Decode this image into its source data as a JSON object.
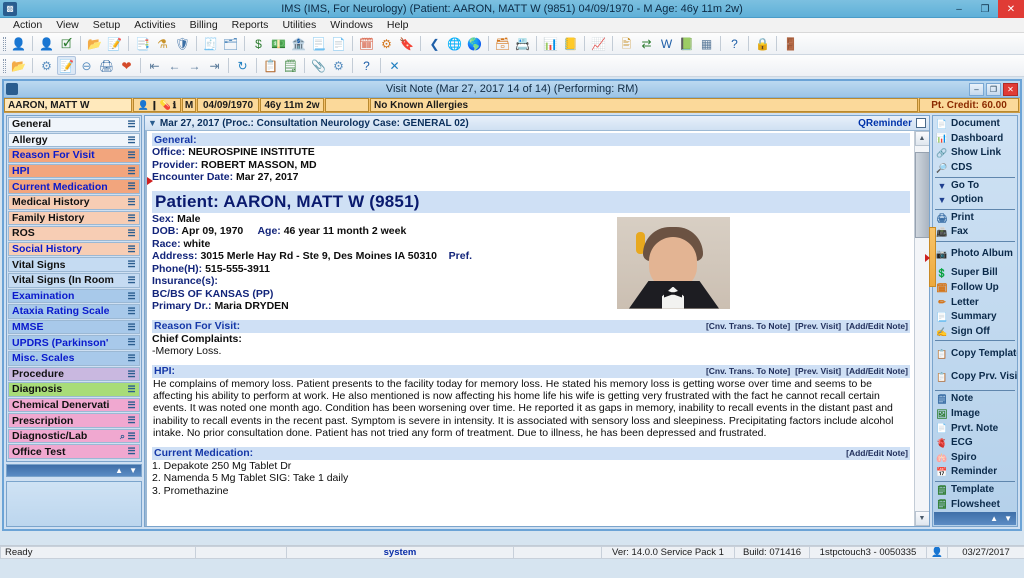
{
  "window": {
    "title": "IMS (IMS, For Neurology)   (Patient: AARON, MATT W (9851) 04/09/1970 - M Age: 46y 11m 2w)",
    "app_icon": "app-icon",
    "minimize": "–",
    "maximize": "❐",
    "close": "✕"
  },
  "menubar": {
    "items": [
      {
        "label": "Action"
      },
      {
        "label": "View"
      },
      {
        "label": "Setup"
      },
      {
        "label": "Activities"
      },
      {
        "label": "Billing"
      },
      {
        "label": "Reports"
      },
      {
        "label": "Utilities"
      },
      {
        "label": "Windows"
      },
      {
        "label": "Help"
      }
    ]
  },
  "toolbar_primary": {
    "groups": [
      {
        "buttons": [
          {
            "icon": "person-icon",
            "glyph": "👤",
            "color": "#e08a2a"
          }
        ]
      },
      {
        "buttons": [
          {
            "icon": "person-add-icon",
            "glyph": "👤",
            "color": "#d4761c"
          },
          {
            "icon": "person-check-icon",
            "glyph": "🗹",
            "color": "#2f7d32"
          }
        ]
      },
      {
        "buttons": [
          {
            "icon": "folder-open-icon",
            "glyph": "📂",
            "color": "#e0a020"
          },
          {
            "icon": "edit-note-icon",
            "glyph": "📝",
            "color": "#d4761c"
          }
        ]
      },
      {
        "buttons": [
          {
            "icon": "chart-review-icon",
            "glyph": "📑",
            "color": "#3a6ea5"
          },
          {
            "icon": "lab-flask-icon",
            "glyph": "⚗",
            "color": "#c8922a"
          },
          {
            "icon": "shield-icon",
            "glyph": "🛡",
            "color": "#3a6ea5"
          }
        ]
      },
      {
        "buttons": [
          {
            "icon": "claim-icon",
            "glyph": "🧾",
            "color": "#3a6ea5"
          },
          {
            "icon": "document-stack-icon",
            "glyph": "🗂",
            "color": "#5a8fc0"
          }
        ]
      },
      {
        "buttons": [
          {
            "icon": "payment-icon",
            "glyph": "$",
            "color": "#2f7d32"
          },
          {
            "icon": "payment-post-icon",
            "glyph": "💵",
            "color": "#2f7d32"
          },
          {
            "icon": "ledger-icon",
            "glyph": "🏦",
            "color": "#3a6ea5"
          },
          {
            "icon": "statement-icon",
            "glyph": "📃",
            "color": "#c8922a"
          },
          {
            "icon": "collections-icon",
            "glyph": "📄",
            "color": "#5a8fc0"
          }
        ]
      },
      {
        "buttons": [
          {
            "icon": "calendar-icon",
            "glyph": "🗓",
            "color": "#d44a2a"
          },
          {
            "icon": "schedule-icon",
            "glyph": "⚙",
            "color": "#d4761c"
          },
          {
            "icon": "appointment-icon",
            "glyph": "🔖",
            "color": "#3a6ea5"
          }
        ]
      },
      {
        "buttons": [
          {
            "icon": "back-arrow-icon",
            "glyph": "❮",
            "color": "#1f5fa8"
          },
          {
            "icon": "globe-icon",
            "glyph": "🌐",
            "color": "#2a7a9a"
          },
          {
            "icon": "globe-alt-icon",
            "glyph": "🌎",
            "color": "#2a7a9a"
          }
        ]
      },
      {
        "buttons": [
          {
            "icon": "eligibility-icon",
            "glyph": "🗃",
            "color": "#d4761c"
          },
          {
            "icon": "claim-status-icon",
            "glyph": "📇",
            "color": "#5a8fc0"
          }
        ]
      },
      {
        "buttons": [
          {
            "icon": "bar-chart-icon",
            "glyph": "📊",
            "color": "#2f7d32"
          },
          {
            "icon": "report-icon",
            "glyph": "📒",
            "color": "#c8922a"
          }
        ]
      },
      {
        "buttons": [
          {
            "icon": "analytics-icon",
            "glyph": "📈",
            "color": "#3a6ea5"
          }
        ]
      },
      {
        "buttons": [
          {
            "icon": "scan-doc-icon",
            "glyph": "🖹",
            "color": "#c8922a"
          },
          {
            "icon": "transfer-icon",
            "glyph": "⇄",
            "color": "#2f7d32"
          },
          {
            "icon": "word-export-icon",
            "glyph": "W",
            "color": "#1f5fa8"
          },
          {
            "icon": "excel-export-icon",
            "glyph": "📗",
            "color": "#2f7d32"
          },
          {
            "icon": "grid-view-icon",
            "glyph": "▦",
            "color": "#5a7a9a"
          }
        ]
      },
      {
        "buttons": [
          {
            "icon": "help-icon",
            "glyph": "?",
            "color": "#1f5fa8"
          }
        ]
      },
      {
        "buttons": [
          {
            "icon": "lock-icon",
            "glyph": "🔒",
            "color": "#d4a01c"
          }
        ]
      },
      {
        "buttons": [
          {
            "icon": "exit-icon",
            "glyph": "🚪",
            "color": "#3a6ea5"
          }
        ]
      }
    ]
  },
  "toolbar_secondary": {
    "groups": [
      {
        "buttons": [
          {
            "icon": "open-chart-icon",
            "glyph": "📂",
            "color": "#e0a020"
          }
        ]
      },
      {
        "buttons": [
          {
            "icon": "add-visit-icon",
            "glyph": "⚙",
            "color": "#5a8fc0"
          },
          {
            "icon": "edit-visit-icon",
            "glyph": "📝",
            "color": "#d4761c",
            "active": true
          },
          {
            "icon": "delete-visit-icon",
            "glyph": "⊖",
            "color": "#5a8fc0"
          },
          {
            "icon": "print-preview-icon",
            "glyph": "🖨",
            "color": "#3a6ea5"
          },
          {
            "icon": "favorite-icon",
            "glyph": "❤",
            "color": "#d44a2a"
          }
        ]
      },
      {
        "buttons": [
          {
            "icon": "first-record-icon",
            "glyph": "⇤",
            "color": "#5a7a9a"
          },
          {
            "icon": "prev-record-icon",
            "glyph": "←",
            "color": "#5a7a9a"
          },
          {
            "icon": "next-record-icon",
            "glyph": "→",
            "color": "#5a7a9a"
          },
          {
            "icon": "last-record-icon",
            "glyph": "⇥",
            "color": "#5a7a9a"
          }
        ]
      },
      {
        "buttons": [
          {
            "icon": "refresh-icon",
            "glyph": "↻",
            "color": "#1f7fc0"
          }
        ]
      },
      {
        "buttons": [
          {
            "icon": "copy-icon",
            "glyph": "📋",
            "color": "#5a8fc0"
          },
          {
            "icon": "template-icon",
            "glyph": "🗒",
            "color": "#2f7d32"
          }
        ]
      },
      {
        "buttons": [
          {
            "icon": "attach-icon",
            "glyph": "📎",
            "color": "#c8922a"
          },
          {
            "icon": "settings-icon",
            "glyph": "⚙",
            "color": "#5a8fc0"
          }
        ]
      },
      {
        "buttons": [
          {
            "icon": "help-circle-icon",
            "glyph": "?",
            "color": "#1f5fa8"
          }
        ]
      },
      {
        "buttons": [
          {
            "icon": "close-window-icon",
            "glyph": "✕",
            "color": "#1f7fc0"
          }
        ]
      }
    ]
  },
  "visit_window": {
    "title": "Visit Note (Mar 27, 2017   14 of 14) (Performing: RM)",
    "icon": "visit-note-icon",
    "minimize": "–",
    "maximize": "❐",
    "close": "✕"
  },
  "patient_banner": {
    "name": "AARON, MATT W",
    "icons": [
      {
        "name": "patient-photo-icon",
        "glyph": "👤"
      },
      {
        "name": "allergy-alert-icon",
        "glyph": "❙"
      },
      {
        "name": "medication-icon",
        "glyph": "💊"
      },
      {
        "name": "info-icon",
        "glyph": "ℹ"
      }
    ],
    "sex": "M",
    "dob": "04/09/1970",
    "age": "46y 11m 2w",
    "blank": "",
    "allergies": "No Known Allergies",
    "credit": "Pt. Credit: 60.00"
  },
  "sidebar": {
    "items": [
      {
        "label": "General",
        "bg": "#f0f5fb",
        "fg": "#111111",
        "icon": "note-icon"
      },
      {
        "label": "Allergy",
        "bg": "#f0f5fb",
        "fg": "#111111",
        "icon": "note-search-icon"
      },
      {
        "label": "Reason For Visit",
        "bg": "#f2a57d",
        "fg": "#0a1acc",
        "icon": "note-icon"
      },
      {
        "label": "HPI",
        "bg": "#f2a57d",
        "fg": "#0a1acc",
        "icon": "note-icon"
      },
      {
        "label": "Current Medication",
        "bg": "#f2a57d",
        "fg": "#0a1acc",
        "icon": "note-icon"
      },
      {
        "label": "Medical History",
        "bg": "#f7cdb4",
        "fg": "#111111",
        "icon": "note-search-icon"
      },
      {
        "label": "Family History",
        "bg": "#f7cdb4",
        "fg": "#111111",
        "icon": "note-icon"
      },
      {
        "label": "ROS",
        "bg": "#f7cdb4",
        "fg": "#111111",
        "icon": "note-search-icon"
      },
      {
        "label": "Social History",
        "bg": "#f7cdb4",
        "fg": "#0a1acc",
        "icon": "note-icon"
      },
      {
        "label": "Vital Signs",
        "bg": "#c5dbf2",
        "fg": "#111111",
        "icon": "note-icon"
      },
      {
        "label": "Vital Signs (In Room",
        "bg": "#c5dbf2",
        "fg": "#111111",
        "icon": "note-icon"
      },
      {
        "label": "Examination",
        "bg": "#a8c9ea",
        "fg": "#0a1acc",
        "icon": "note-search-icon"
      },
      {
        "label": "Ataxia Rating Scale",
        "bg": "#a8c9ea",
        "fg": "#0a1acc",
        "icon": "note-search-icon"
      },
      {
        "label": "MMSE",
        "bg": "#a8c9ea",
        "fg": "#0a1acc",
        "icon": "note-search-icon"
      },
      {
        "label": "UPDRS (Parkinson'",
        "bg": "#a8c9ea",
        "fg": "#0a1acc",
        "icon": "note-search-icon"
      },
      {
        "label": "Misc. Scales",
        "bg": "#a8c9ea",
        "fg": "#0a1acc",
        "icon": "note-search-icon"
      },
      {
        "label": "Procedure",
        "bg": "#c9b8e0",
        "fg": "#111111",
        "icon": "note-icon"
      },
      {
        "label": "Diagnosis",
        "bg": "#a8dc78",
        "fg": "#111111",
        "icon": "note-icon"
      },
      {
        "label": "Chemical Denervati",
        "bg": "#f0a8d0",
        "fg": "#111111",
        "icon": "note-icon"
      },
      {
        "label": "Prescription",
        "bg": "#f0a8d0",
        "fg": "#111111",
        "icon": "note-icon"
      },
      {
        "label": "Diagnostic/Lab",
        "bg": "#f0a8d0",
        "fg": "#111111",
        "icon": "note-icon",
        "icon2": "search-icon"
      },
      {
        "label": "Office Test",
        "bg": "#f0a8d0",
        "fg": "#111111",
        "icon": "note-icon"
      }
    ],
    "scroll_up": "▲",
    "scroll_down": "▼"
  },
  "document": {
    "tab": {
      "chevron": "▼",
      "label": "Mar 27, 2017  (Proc.: Consultation Neurology  Case: GENERAL 02)",
      "qreminder": "QReminder"
    },
    "general": {
      "heading": "General:",
      "office_label": "Office:",
      "office_value": "NEUROSPINE INSTITUTE",
      "provider_label": "Provider:",
      "provider_value": "ROBERT MASSON, MD",
      "encounter_label": "Encounter Date:",
      "encounter_value": "Mar 27, 2017"
    },
    "patient": {
      "title": "Patient: AARON, MATT W  (9851)",
      "sex_label": "Sex:",
      "sex_value": "Male",
      "dob_label": "DOB:",
      "dob_value": "Apr 09, 1970",
      "age_label": "Age:",
      "age_value": "46 year 11 month 2 week",
      "race_label": "Race:",
      "race_value": "white",
      "address_label": "Address:",
      "address_value": "3015 Merle Hay Rd - Ste 9,  Des Moines  IA  50310",
      "address_pref": "Pref.",
      "phone_label": "Phone(H):",
      "phone_value": "515-555-3911",
      "insurance_label": "Insurance(s):",
      "insurance_value": "BC/BS OF KANSAS (PP)",
      "primary_label": "Primary Dr.:",
      "primary_value": "Maria DRYDEN",
      "photo": "patient-photo"
    },
    "reason_for_visit": {
      "heading": "Reason For Visit:",
      "actions": [
        "[Cnv. Trans. To Note]",
        "[Prev. Visit]",
        "[Add/Edit Note]"
      ],
      "subheading": "Chief Complaints:",
      "body": "-Memory Loss."
    },
    "hpi": {
      "heading": "HPI:",
      "actions": [
        "[Cnv. Trans. To Note]",
        "[Prev. Visit]",
        "[Add/Edit Note]"
      ],
      "body": "He complains of memory loss. Patient presents to the facility today for memory loss. He stated his memory loss is getting worse over time and seems to be affecting his ability to perform at work. He also mentioned is now affecting his home life his wife is getting very frustrated with the fact he cannot recall certain events. It was noted one month ago. Condition has been worsening  over time. He reported it as gaps in memory, inability to recall events in the distant past and inability to recall events in the recent past. Symptom is severe in intensity. It is associated with sensory loss and sleepiness. Precipitating factors include alcohol intake. No prior consultation done. Patient has not tried any form of treatment. Due to illness, he has been depressed and frustrated."
    },
    "current_medication": {
      "heading": "Current Medication:",
      "actions": [
        "[Add/Edit Note]"
      ],
      "items": [
        "1. Depakote 250 Mg Tablet Dr",
        "2. Namenda 5 Mg Tablet  SIG: Take 1 daily",
        "3. Promethazine"
      ]
    },
    "scroll_up": "▲",
    "scroll_down": "▼"
  },
  "right_panel": {
    "groups": [
      {
        "items": [
          {
            "label": "Document",
            "icon": "document-icon",
            "glyph": "📄",
            "color": "#3a6ea5"
          },
          {
            "label": "Dashboard",
            "icon": "dashboard-icon",
            "glyph": "📊",
            "color": "#d4761c"
          },
          {
            "label": "Show Link",
            "icon": "link-icon",
            "glyph": "🔗",
            "color": "#5a8fc0"
          },
          {
            "label": "CDS",
            "icon": "cds-icon",
            "glyph": "🔎",
            "color": "#3a6ea5"
          }
        ]
      },
      {
        "items": [
          {
            "label": "Go To",
            "icon": "chevron-down-icon",
            "glyph": "▼",
            "color": "#1f3f8f"
          },
          {
            "label": "Option",
            "icon": "chevron-down-icon",
            "glyph": "▼",
            "color": "#1f3f8f"
          }
        ]
      },
      {
        "items": [
          {
            "label": "Print",
            "icon": "print-icon",
            "glyph": "🖨",
            "color": "#3a6ea5"
          },
          {
            "label": "Fax",
            "icon": "fax-icon",
            "glyph": "📠",
            "color": "#5a8fc0"
          }
        ]
      },
      {
        "items": [
          {
            "label": "Photo Album",
            "icon": "photo-album-icon",
            "glyph": "📷",
            "color": "#5a8fc0",
            "two_line": true
          },
          {
            "label": "Super Bill",
            "icon": "super-bill-icon",
            "glyph": "💲",
            "color": "#2f7d32"
          },
          {
            "label": "Follow Up",
            "icon": "follow-up-icon",
            "glyph": "🗓",
            "color": "#d4761c"
          },
          {
            "label": "Letter",
            "icon": "letter-icon",
            "glyph": "✏",
            "color": "#d4761c"
          },
          {
            "label": "Summary",
            "icon": "summary-icon",
            "glyph": "📃",
            "color": "#3a6ea5"
          },
          {
            "label": "Sign Off",
            "icon": "sign-off-icon",
            "glyph": "✍",
            "color": "#2f7d32"
          }
        ]
      },
      {
        "items": [
          {
            "label": "Copy Template",
            "icon": "copy-template-icon",
            "glyph": "📋",
            "color": "#5a8fc0",
            "two_line": true
          },
          {
            "label": "Copy Prv. Visit",
            "icon": "copy-prev-visit-icon",
            "glyph": "📋",
            "color": "#5a8fc0",
            "two_line": true
          }
        ]
      },
      {
        "items": [
          {
            "label": "Note",
            "icon": "note-icon",
            "glyph": "🗒",
            "color": "#3a6ea5"
          },
          {
            "label": "Image",
            "icon": "image-icon",
            "glyph": "🖼",
            "color": "#2f7d32"
          },
          {
            "label": "Prvt. Note",
            "icon": "private-note-icon",
            "glyph": "📄",
            "color": "#c8922a"
          },
          {
            "label": "ECG",
            "icon": "ecg-icon",
            "glyph": "🫀",
            "color": "#5a8fc0"
          },
          {
            "label": "Spiro",
            "icon": "spiro-icon",
            "glyph": "🫁",
            "color": "#5a8fc0"
          },
          {
            "label": "Reminder",
            "icon": "reminder-icon",
            "glyph": "📅",
            "color": "#d4761c"
          }
        ]
      },
      {
        "items": [
          {
            "label": "Template",
            "icon": "template-icon",
            "glyph": "🗒",
            "color": "#2f7d32"
          },
          {
            "label": "Flowsheet",
            "icon": "flowsheet-icon",
            "glyph": "🗒",
            "color": "#2f7d32"
          }
        ]
      }
    ],
    "scroll_up": "▲",
    "scroll_down": "▼"
  },
  "statusbar": {
    "ready": "Ready",
    "blank1": "",
    "system": "system",
    "blank2": "",
    "version": "Ver: 14.0.0 Service Pack 1",
    "build": "Build: 071416",
    "host": "1stpctouch3 - 0050335",
    "status_icon": "user-status-icon",
    "date": "03/27/2017"
  }
}
